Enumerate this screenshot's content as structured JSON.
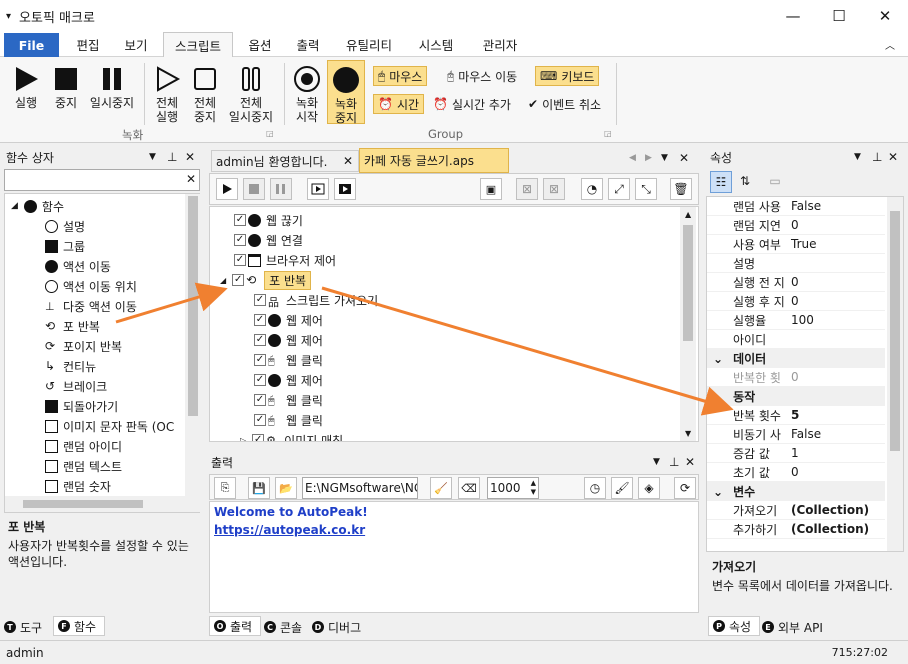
{
  "window": {
    "title": "오토픽 매크로"
  },
  "menu": [
    "File",
    "편집",
    "보기",
    "스크립트",
    "옵션",
    "출력",
    "유틸리티",
    "시스템",
    "관리자"
  ],
  "ribbon": {
    "rec_group_btns": [
      "실행",
      "중지",
      "일시중지",
      "전체\n실행",
      "전체\n중지",
      "전체\n일시중지"
    ],
    "rec_group_label": "녹화",
    "group2_btns": [
      "녹화\n시작",
      "녹화\n중지"
    ],
    "pills": [
      "마우스",
      "마우스 이동",
      "키보드",
      "시간",
      "실시간 추가",
      "이벤트 취소"
    ],
    "group2_label": "Group"
  },
  "left_panel": {
    "title": "함수 상자",
    "root": "함수",
    "items": [
      "설명",
      "그룹",
      "액션 이동",
      "액션 이동 위치",
      "다중 액션 이동",
      "포 반복",
      "포이지 반복",
      "컨티뉴",
      "브레이크",
      "되돌아가기",
      "이미지 문자 판독 (OC",
      "랜덤 아이디",
      "랜덤 텍스트",
      "랜덤 숫자"
    ],
    "desc_title": "포 반복",
    "desc_text": "사용자가 반복횟수를 설정할 수 있는 액션입니다.",
    "tabs": [
      "도구",
      "함수"
    ]
  },
  "doc_tabs": [
    "admin님 환영합니다.",
    "카페 자동 글쓰기.aps"
  ],
  "script_tree": [
    "웹 끊기",
    "웹 연결",
    "브라우저 제어",
    "포 반복",
    "스크립트 가져오기",
    "웹 제어",
    "웹 제어",
    "웹 클릭",
    "웹 제어",
    "웹 클릭",
    "웹 클릭",
    "이미지 매칭"
  ],
  "output": {
    "title": "출력",
    "path": "E:\\NGMsoftware\\NG",
    "number": "1000",
    "welcome": "Welcome to AutoPeak!",
    "link": "https://autopeak.co.kr",
    "tabs": [
      "출력",
      "콘솔",
      "디버그"
    ]
  },
  "props": {
    "title": "속성",
    "rows1": [
      [
        "랜덤 사용",
        "False"
      ],
      [
        "랜덤 지연",
        "0"
      ],
      [
        "사용 여부",
        "True"
      ],
      [
        "설명",
        ""
      ],
      [
        "실행 전 지",
        "0"
      ],
      [
        "실행 후 지",
        "0"
      ],
      [
        "실행율",
        "100"
      ],
      [
        "아이디",
        ""
      ]
    ],
    "cat_data": "데이터",
    "rows2": [
      [
        "반복한 횟",
        "0"
      ]
    ],
    "cat_action": "동작",
    "rows3": [
      [
        "반복 횟수",
        "5"
      ],
      [
        "비동기 사",
        "False"
      ],
      [
        "증감 값",
        "1"
      ],
      [
        "초기 값",
        "0"
      ]
    ],
    "cat_var": "변수",
    "rows4": [
      [
        "가져오기",
        "(Collection)"
      ],
      [
        "추가하기",
        "(Collection)"
      ]
    ],
    "desc_title": "가져오기",
    "desc_text": "변수 목록에서 데이터를 가져옵니다.",
    "tabs": [
      "속성",
      "외부 API"
    ]
  },
  "status": {
    "user": "admin",
    "time": "715:27:02"
  },
  "colors": {
    "file_blue": "#2b68c4",
    "arrow": "#f08030",
    "highlight": "#fbdf8e",
    "link": "#0000ee"
  }
}
